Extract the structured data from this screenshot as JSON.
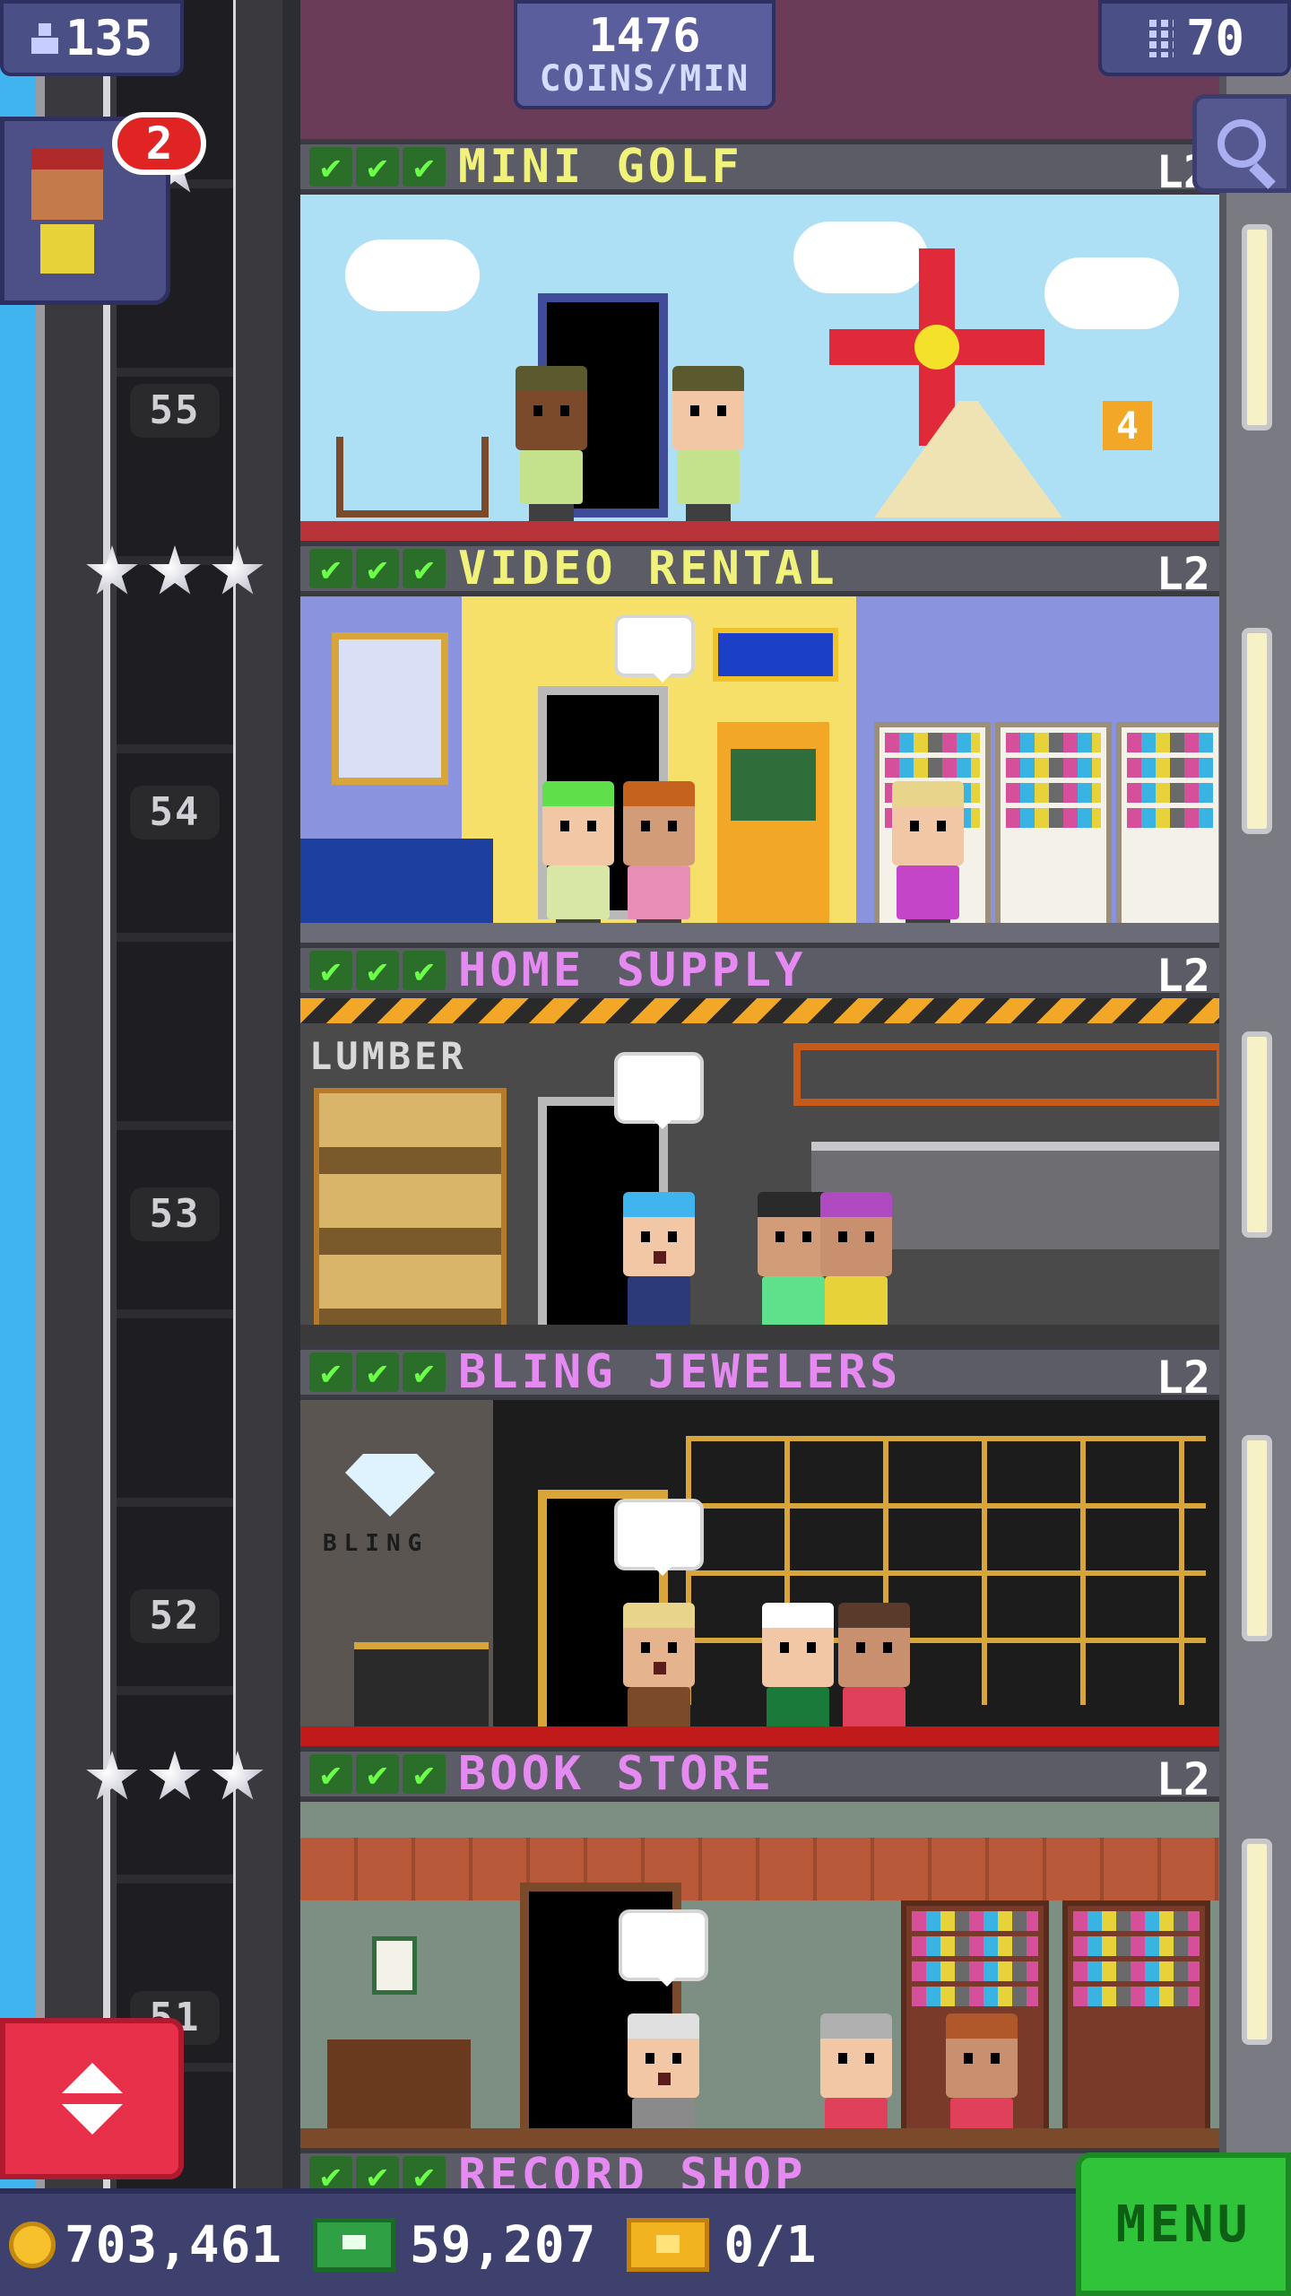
{
  "hud": {
    "population": "135",
    "coins_rate_value": "1476",
    "coins_rate_unit": "COINS/MIN",
    "floor_count": "70"
  },
  "visitor": {
    "badge_count": "2"
  },
  "shaft": {
    "floor_numbers": [
      "55",
      "54",
      "53",
      "52",
      "51"
    ]
  },
  "floors": [
    {
      "name": "MINI GOLF",
      "level": "L2",
      "name_color": "#f1f27a",
      "sign_text": "4"
    },
    {
      "name": "VIDEO RENTAL",
      "level": "L2",
      "name_color": "#f1f27a"
    },
    {
      "name": "HOME SUPPLY",
      "level": "L2",
      "name_color": "#e58af0",
      "sign_text": "LUMBER"
    },
    {
      "name": "BLING JEWELERS",
      "level": "L2",
      "name_color": "#e58af0",
      "sign_text": "BLING"
    },
    {
      "name": "BOOK STORE",
      "level": "L2",
      "name_color": "#e58af0"
    },
    {
      "name": "RECORD SHOP",
      "name_color": "#e58af0"
    }
  ],
  "bottom": {
    "coins": "703,461",
    "bux": "59,207",
    "tickets": "0/1",
    "menu_label": "MENU"
  },
  "icons": {
    "population": "person-icon",
    "floors": "building-icon",
    "search": "magnifier-icon",
    "elevator": "up-down-arrows-icon",
    "coin": "coin-icon",
    "bux": "bux-icon",
    "ticket": "ticket-icon"
  }
}
